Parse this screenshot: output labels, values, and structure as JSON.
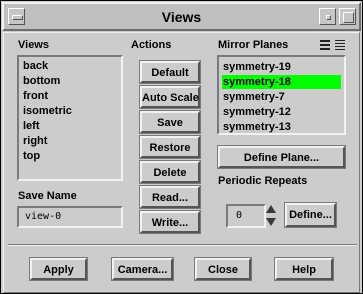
{
  "window": {
    "title": "Views"
  },
  "views": {
    "label": "Views",
    "items": [
      "back",
      "bottom",
      "front",
      "isometric",
      "left",
      "right",
      "top"
    ]
  },
  "actions": {
    "label": "Actions",
    "buttons": [
      "Default",
      "Auto Scale",
      "Save",
      "Restore",
      "Delete",
      "Read...",
      "Write..."
    ]
  },
  "mirror_planes": {
    "label": "Mirror Planes",
    "items": [
      "symmetry-19",
      "symmetry-18",
      "symmetry-7",
      "symmetry-12",
      "symmetry-13"
    ],
    "selected": "symmetry-18",
    "define_plane_label": "Define Plane..."
  },
  "save_name": {
    "label": "Save Name",
    "value": "view-0"
  },
  "periodic_repeats": {
    "label": "Periodic Repeats",
    "value": "0",
    "define_label": "Define..."
  },
  "footer": {
    "apply": "Apply",
    "camera": "Camera...",
    "close": "Close",
    "help": "Help"
  },
  "colors": {
    "selection": "#00ff00",
    "background": "#cccccc"
  }
}
